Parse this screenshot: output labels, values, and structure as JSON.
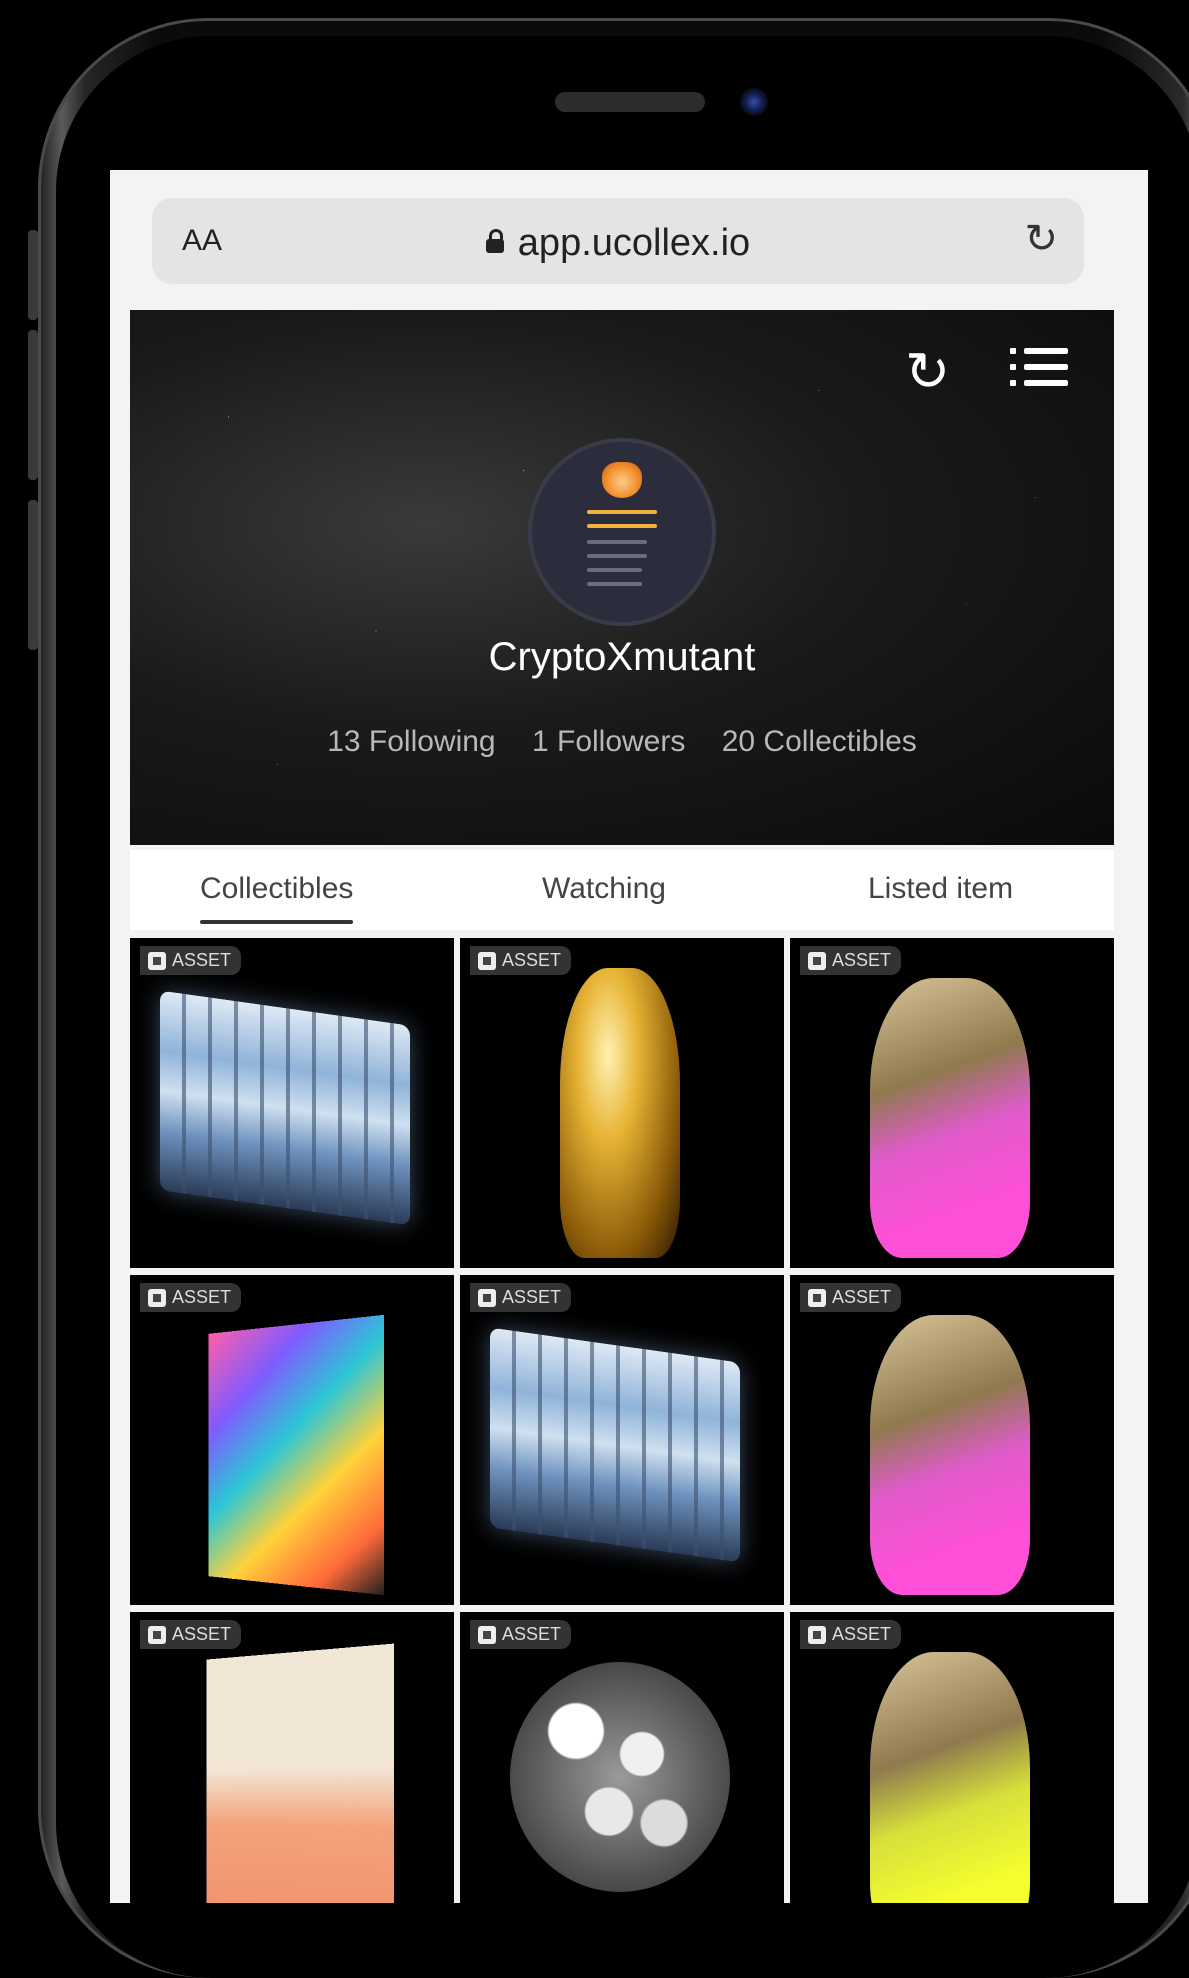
{
  "browser": {
    "text_size_label": "AA",
    "url": "app.ucollex.io"
  },
  "profile": {
    "username": "CryptoXmutant",
    "following": "13 Following",
    "followers": "1 Followers",
    "collectibles": "20 Collectibles"
  },
  "tabs": [
    {
      "label": "Collectibles",
      "active": true
    },
    {
      "label": "Watching",
      "active": false
    },
    {
      "label": "Listed item",
      "active": false
    }
  ],
  "grid": {
    "badge_label": "ASSET",
    "items": [
      {
        "art": "bus"
      },
      {
        "art": "gold-figure"
      },
      {
        "art": "pink-figure"
      },
      {
        "art": "portrait-painting"
      },
      {
        "art": "bus"
      },
      {
        "art": "pink-figure"
      },
      {
        "art": "buddha-canvas"
      },
      {
        "art": "bubble-sculpture"
      },
      {
        "art": "yellow-figure"
      }
    ]
  },
  "colors": {
    "header_bg": "#111111",
    "screen_bg": "#f3f3f3",
    "tab_active_underline": "#333333"
  }
}
